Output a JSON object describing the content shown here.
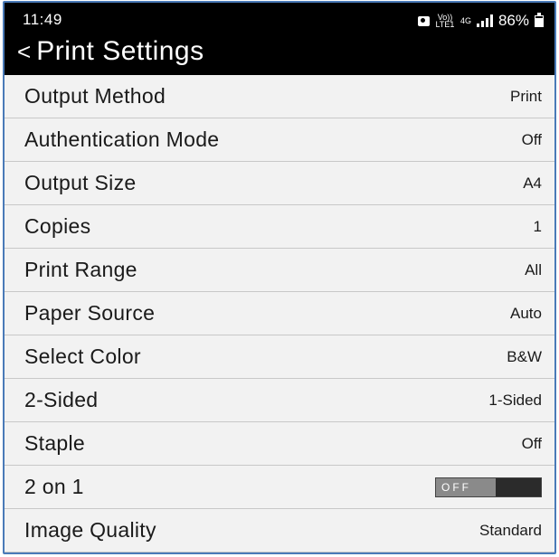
{
  "status_bar": {
    "time": "11:49",
    "network_small": "Vo)) LTE1",
    "network_type": "4G",
    "battery_percent": "86%"
  },
  "header": {
    "back_glyph": "<",
    "title": "Print Settings"
  },
  "settings": [
    {
      "label": "Output Method",
      "value": "Print"
    },
    {
      "label": "Authentication Mode",
      "value": "Off"
    },
    {
      "label": "Output Size",
      "value": "A4"
    },
    {
      "label": "Copies",
      "value": "1"
    },
    {
      "label": "Print Range",
      "value": "All"
    },
    {
      "label": "Paper Source",
      "value": "Auto"
    },
    {
      "label": "Select Color",
      "value": "B&W"
    },
    {
      "label": "2-Sided",
      "value": "1-Sided"
    },
    {
      "label": "Staple",
      "value": "Off"
    },
    {
      "label": "2 on 1",
      "toggle": {
        "text": "OFF",
        "state": "off"
      }
    },
    {
      "label": "Image Quality",
      "value": "Standard"
    }
  ],
  "colors": {
    "header_bg": "#000000",
    "row_bg": "#f2f2f2",
    "divider": "#c8c8c8",
    "frame_border": "#4a7ab8"
  }
}
